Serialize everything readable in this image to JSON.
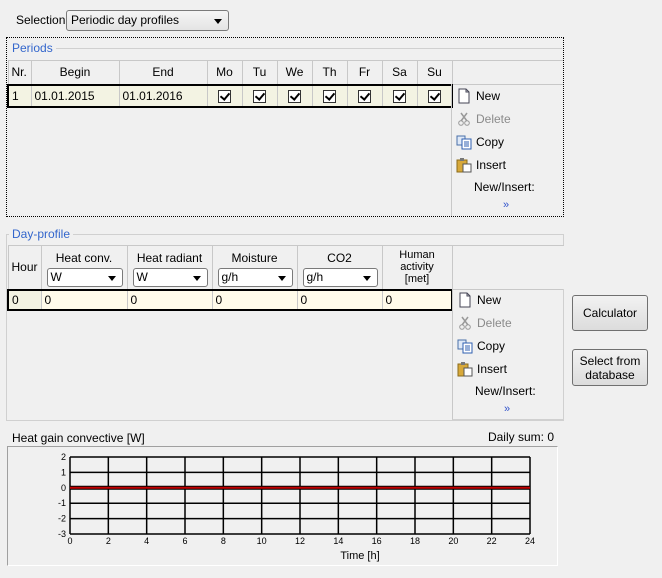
{
  "selection": {
    "label": "Selection",
    "value": "Periodic day profiles"
  },
  "periods": {
    "title": "Periods",
    "columns": [
      "Nr.",
      "Begin",
      "End",
      "Mo",
      "Tu",
      "We",
      "Th",
      "Fr",
      "Sa",
      "Su"
    ],
    "rows": [
      {
        "nr": "1",
        "begin": "01.01.2015",
        "end": "01.01.2016",
        "days": [
          true,
          true,
          true,
          true,
          true,
          true,
          true
        ]
      }
    ],
    "actions": {
      "new": "New",
      "delete": "Delete",
      "copy": "Copy",
      "insert": "Insert",
      "new_insert": "New/Insert:",
      "more": "»"
    }
  },
  "day_profile": {
    "title": "Day-profile",
    "columns": {
      "hour": "Hour",
      "heat_conv": {
        "label": "Heat conv.",
        "unit": "W"
      },
      "heat_radiant": {
        "label": "Heat radiant",
        "unit": "W"
      },
      "moisture": {
        "label": "Moisture",
        "unit": "g/h"
      },
      "co2": {
        "label": "CO2",
        "unit": "g/h"
      },
      "human_activity": {
        "label1": "Human",
        "label2": "activity",
        "label3": "[met]"
      }
    },
    "rows": [
      {
        "hour": "0",
        "heat_conv": "0",
        "heat_radiant": "0",
        "moisture": "0",
        "co2": "0",
        "human_activity": "0"
      }
    ],
    "actions": {
      "new": "New",
      "delete": "Delete",
      "copy": "Copy",
      "insert": "Insert",
      "new_insert": "New/Insert:",
      "more": "»"
    }
  },
  "buttons": {
    "calculator": "Calculator",
    "select_db_line1": "Select from",
    "select_db_line2": "database"
  },
  "chart_header": {
    "title": "Heat gain convective [W]",
    "daily_sum": "Daily sum: 0"
  },
  "chart_data": {
    "type": "line",
    "title": "Heat gain convective [W]",
    "xlabel": "Time [h]",
    "ylabel": "",
    "xlim": [
      0,
      24
    ],
    "ylim": [
      -3,
      2
    ],
    "x_ticks": [
      "0",
      "2",
      "4",
      "6",
      "8",
      "10",
      "12",
      "14",
      "16",
      "18",
      "20",
      "22",
      "24"
    ],
    "y_ticks": [
      "2",
      "1",
      "0",
      "-1",
      "-2",
      "-3"
    ],
    "grid": true,
    "series": [
      {
        "name": "Heat gain convective",
        "color": "#c00000",
        "x": [
          0,
          24
        ],
        "y": [
          0,
          0
        ]
      }
    ]
  },
  "colors": {
    "legend": "#3366cc",
    "series": "#c00000",
    "row_bg": "#f3f3e3"
  }
}
